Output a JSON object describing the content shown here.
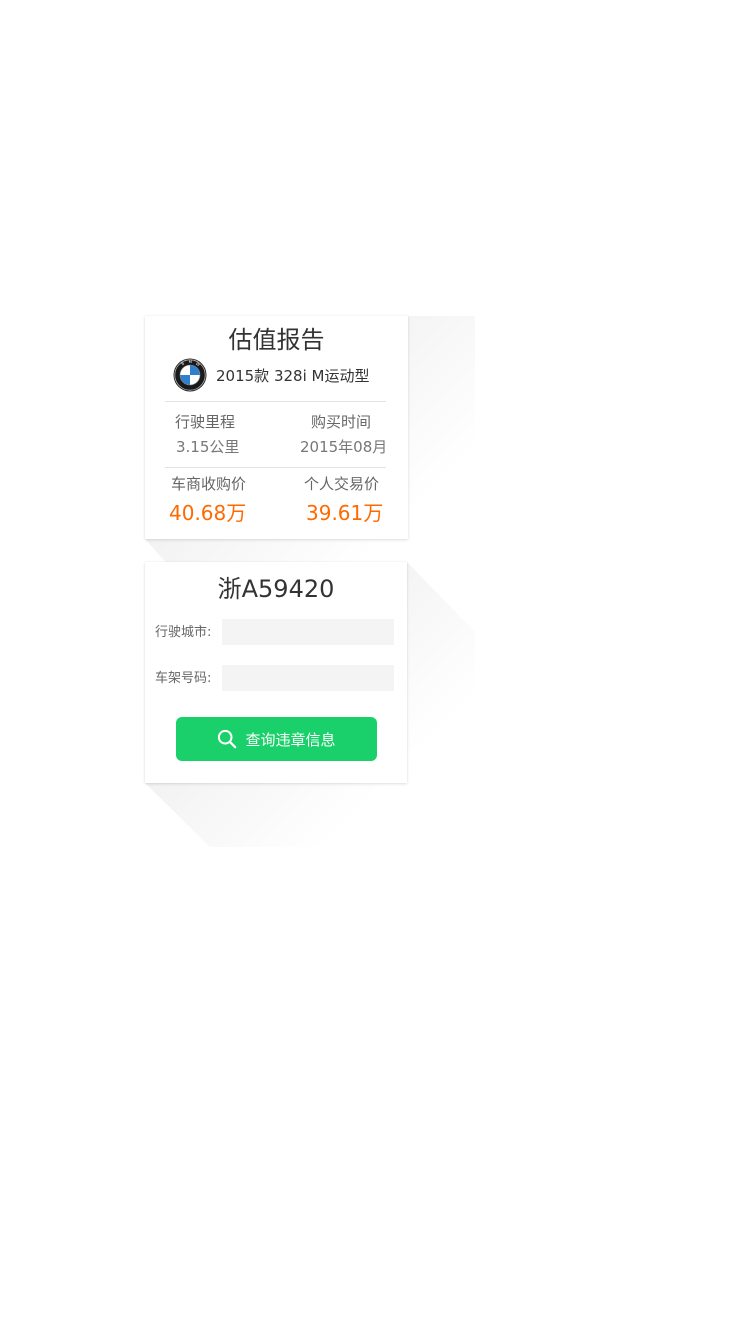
{
  "report": {
    "title": "估值报告",
    "model": "2015款 328i M运动型",
    "brand_icon": "bmw-logo-icon",
    "mileage_label": "行驶里程",
    "mileage_value": "3.15公里",
    "purchase_label": "购买时间",
    "purchase_value": "2015年08月",
    "dealer_price_label": "车商收购价",
    "dealer_price_value": "40.68万",
    "private_price_label": "个人交易价",
    "private_price_value": "39.61万",
    "price_color": "#ff6a00"
  },
  "violation": {
    "plate": "浙A59420",
    "city_label": "行驶城市:",
    "city_value": "",
    "vin_label": "车架号码:",
    "vin_value": "",
    "button_label": "查询违章信息",
    "button_icon": "search-icon",
    "button_color": "#1ad06b"
  }
}
